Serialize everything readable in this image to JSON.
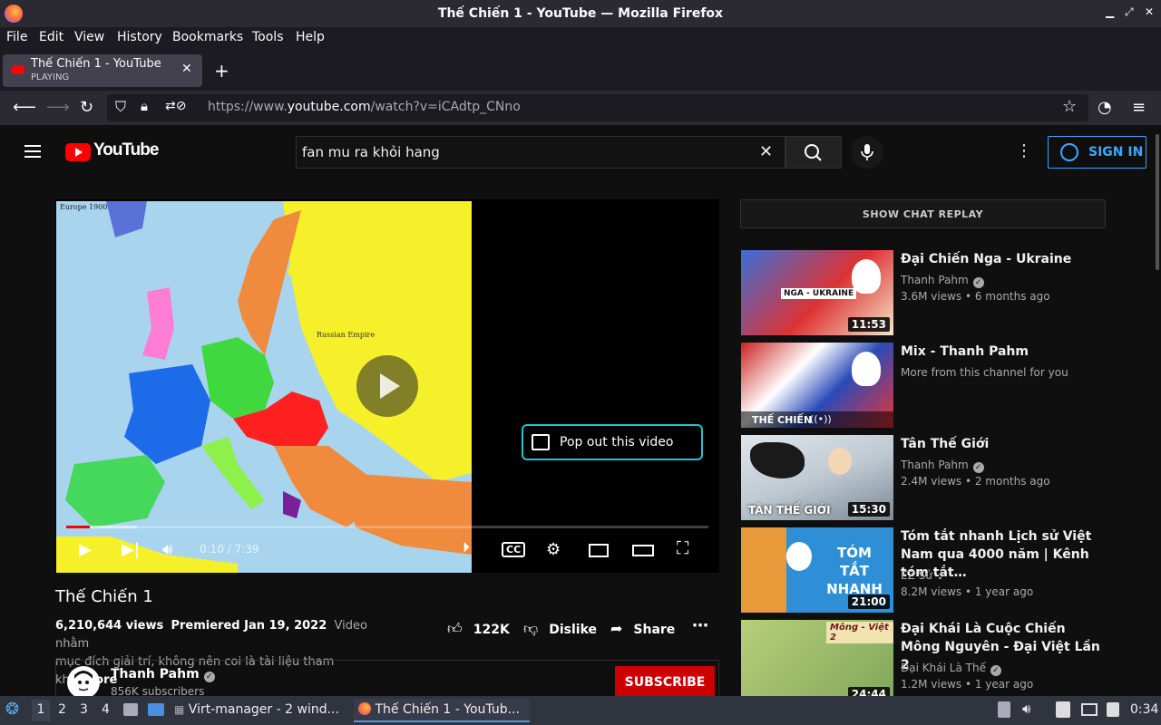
{
  "window": {
    "title": "Thế Chiến 1 - YouTube — Mozilla Firefox",
    "controls": [
      "▁",
      "⤢",
      "✕"
    ]
  },
  "menu": [
    "File",
    "Edit",
    "View",
    "History",
    "Bookmarks",
    "Tools",
    "Help"
  ],
  "tab": {
    "title": "Thế Chiến 1 - YouTube",
    "status": "PLAYING"
  },
  "address": {
    "prefix": "https://www.",
    "host": "youtube.com",
    "path": "/watch?v=iCAdtp_CNno"
  },
  "yt": {
    "logo": "YouTube",
    "search_value": "fan mu ra khỏi hang",
    "sign_in": "SIGN IN"
  },
  "player": {
    "map_label": "Europe 1900",
    "map_text_russian": "Russian    Empire",
    "popout": "Pop out this video",
    "time": "0:10 / 7:39",
    "progress_played": 0.037,
    "progress_buffered": 0.11
  },
  "video": {
    "title": "Thế Chiến 1",
    "views": "6,210,644 views",
    "premiered": "Premiered Jan 19, 2022",
    "desc_line1": "Video nhằm",
    "desc_line2": "mục đích giải trí, không nên coi là tài liệu tham kh",
    "more": "...more",
    "likes": "122K",
    "dislike": "Dislike",
    "share": "Share"
  },
  "channel": {
    "name": "Thanh Pahm",
    "subs": "856K subscribers",
    "subscribe": "SUBSCRIBE"
  },
  "sidebar": {
    "chat_replay": "SHOW CHAT REPLAY",
    "recs": [
      {
        "title": "Đại Chiến Nga - Ukraine",
        "channel": "Thanh Pahm",
        "meta": "3.6M views • 6 months ago",
        "duration": "11:53",
        "thumb_text": "NGA - UKRAINE"
      },
      {
        "title": "Mix - Thanh Pahm",
        "channel": "More from this channel for you",
        "meta": "",
        "duration": "",
        "thumb_text": "THẾ CHIẾN"
      },
      {
        "title": "Tân Thế Giới",
        "channel": "Thanh Pahm",
        "meta": "2.4M views • 2 months ago",
        "duration": "15:30",
        "thumb_text": "TÂN THẾ GIỚI"
      },
      {
        "title": "Tóm tắt nhanh Lịch sử Việt Nam qua 4000 năm | Kênh tóm tắt…",
        "channel": "EZ Sử",
        "meta": "8.2M views • 1 year ago",
        "duration": "21:00",
        "thumb_text": "TÓM TẮT NHANH"
      },
      {
        "title": "Đại Khái Là Cuộc Chiến Mông Nguyên - Đại Việt Lần 2",
        "channel": "Đại Khái Là Thế",
        "meta": "1.2M views • 1 year ago",
        "duration": "24:44",
        "thumb_text": "Mông - Việt 2"
      }
    ]
  },
  "taskbar": {
    "workspaces": [
      "1",
      "2",
      "3",
      "4"
    ],
    "task1": "Virt-manager - 2 wind...",
    "task2": "Thế Chiến 1 - YouTub...",
    "clock": "0:34"
  },
  "colors": {
    "yt_red": "#ff0000",
    "accent_blue": "#3ea6ff",
    "popout_border": "#27c2cf"
  }
}
